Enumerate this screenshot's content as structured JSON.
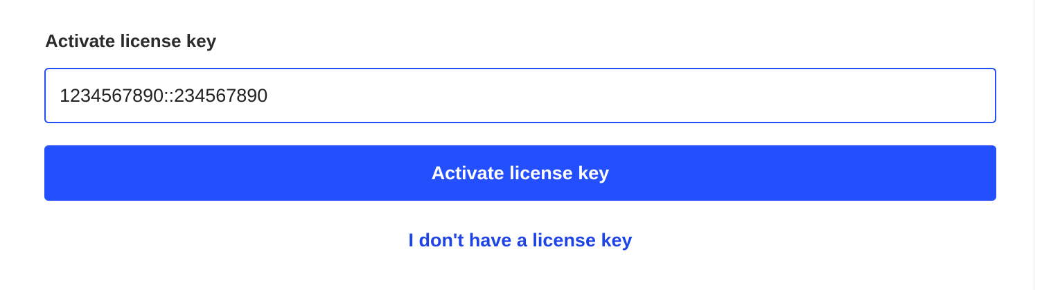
{
  "form": {
    "label": "Activate license key",
    "key_value": "1234567890::234567890",
    "submit_label": "Activate license key",
    "no_key_link": "I don't have a license key"
  },
  "colors": {
    "accent": "#244ffd",
    "link": "#1f44e6",
    "input_border": "#2450f5",
    "notice_border": "#f6e3a8"
  }
}
